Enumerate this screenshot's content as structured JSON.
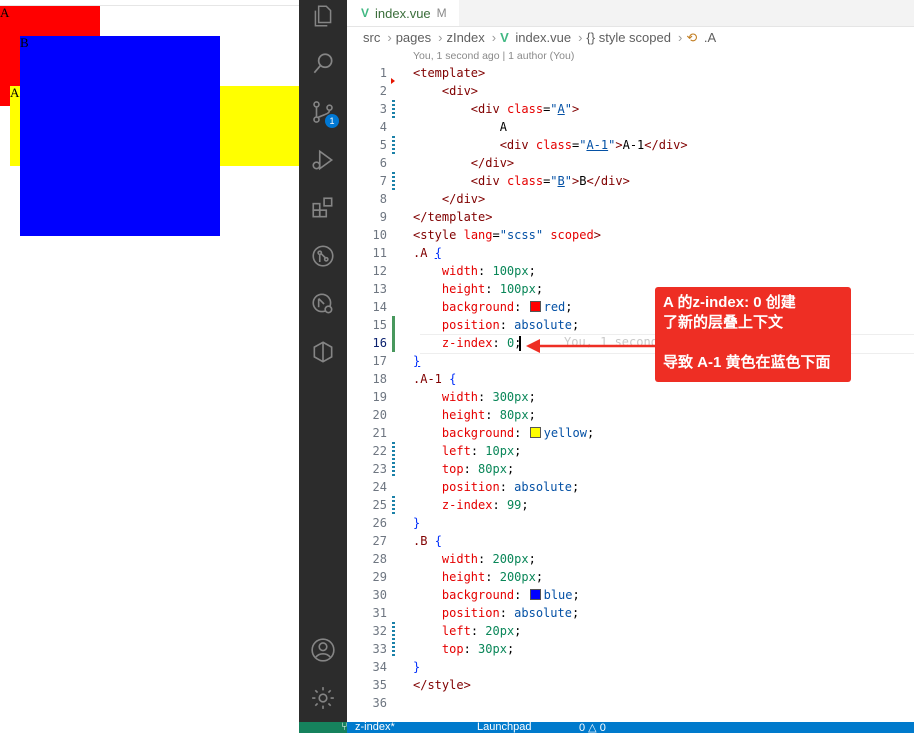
{
  "preview": {
    "box_a_label": "A",
    "box_b_label": "B",
    "box_a1_label": "A",
    "colors": {
      "a": "#ff0000",
      "a1": "#ffff00",
      "b": "#0000ff"
    }
  },
  "activity_bar": {
    "icons": [
      "explorer-icon",
      "search-icon",
      "source-control-icon",
      "run-debug-icon",
      "extensions-icon",
      "git-graph-icon",
      "remote-icon",
      "docker-icon",
      "account-icon",
      "settings-gear-icon"
    ],
    "source_control_badge": "1"
  },
  "tab": {
    "icon": "V",
    "filename": "index.vue",
    "modified": "M"
  },
  "breadcrumb": [
    "src",
    "pages",
    "zIndex",
    "index.vue",
    "{} style scoped",
    ".A"
  ],
  "blame_header": "You, 1 second ago | 1 author (You)",
  "ghost_text": "You, 1 second ago",
  "line_numbers": [
    "1",
    "2",
    "3",
    "4",
    "5",
    "6",
    "7",
    "8",
    "9",
    "10",
    "11",
    "12",
    "13",
    "14",
    "15",
    "16",
    "17",
    "18",
    "19",
    "20",
    "21",
    "22",
    "23",
    "24",
    "25",
    "26",
    "27",
    "28",
    "29",
    "30",
    "31",
    "32",
    "33",
    "34",
    "35",
    "36"
  ],
  "annotation": {
    "line1": "A 的z-index: 0 创建",
    "line2": "了新的层叠上下文",
    "line3": "导致 A-1 黄色在蓝色下面"
  },
  "statusbar": {
    "branch": "z-index*",
    "launchpad": "Launchpad",
    "problems": "0 △ 0"
  }
}
